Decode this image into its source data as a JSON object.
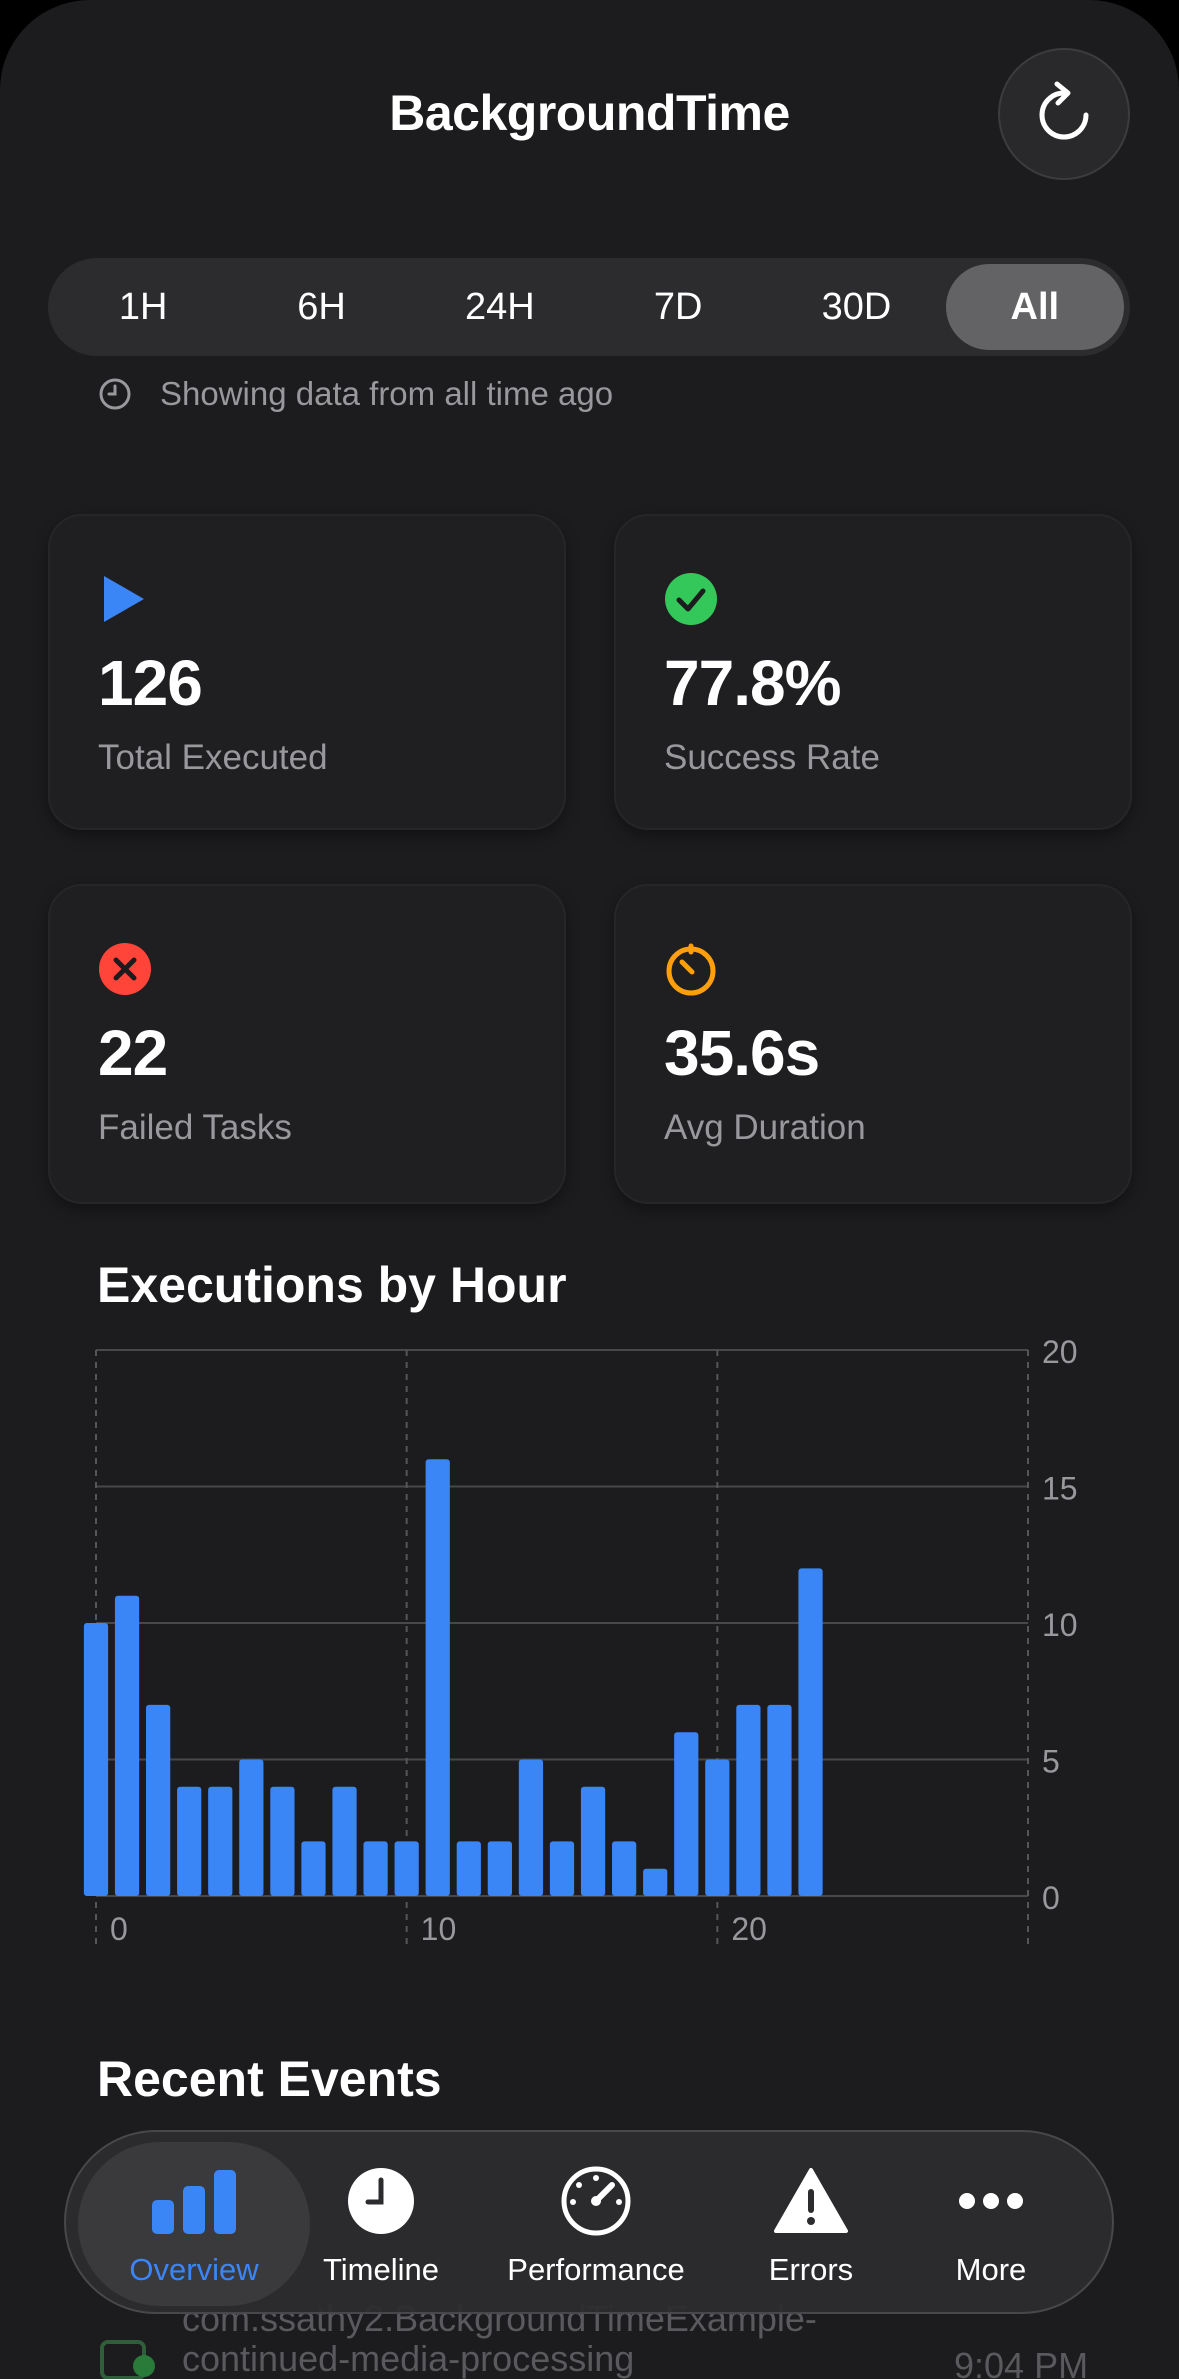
{
  "app": {
    "title": "BackgroundTime"
  },
  "refresh": {
    "icon": "refresh-icon"
  },
  "time_range": {
    "options": [
      "1H",
      "6H",
      "24H",
      "7D",
      "30D",
      "All"
    ],
    "selected": "All",
    "note": "Showing data from all time ago",
    "note_icon": "clock-icon"
  },
  "stats": [
    {
      "icon": "play-icon",
      "color": "#3a86f7",
      "value": "126",
      "label": "Total Executed"
    },
    {
      "icon": "checkmark-circle-icon",
      "color": "#34c759",
      "value": "77.8%",
      "label": "Success Rate"
    },
    {
      "icon": "x-circle-icon",
      "color": "#ff453a",
      "value": "22",
      "label": "Failed Tasks"
    },
    {
      "icon": "timer-icon",
      "color": "#ff9f0a",
      "value": "35.6s",
      "label": "Avg Duration"
    }
  ],
  "chart_section": {
    "title": "Executions by Hour"
  },
  "chart_data": {
    "type": "bar",
    "title": "Executions by Hour",
    "x": [
      0,
      1,
      2,
      3,
      4,
      5,
      6,
      7,
      8,
      9,
      10,
      11,
      12,
      13,
      14,
      15,
      16,
      17,
      18,
      19,
      20,
      21,
      22,
      23
    ],
    "values": [
      10,
      11,
      7,
      4,
      4,
      5,
      4,
      2,
      4,
      2,
      2,
      16,
      2,
      2,
      5,
      2,
      4,
      2,
      1,
      6,
      5,
      7,
      7,
      12
    ],
    "x_ticks": [
      "0",
      "10",
      "20"
    ],
    "y_ticks": [
      "0",
      "5",
      "10",
      "15",
      "20"
    ],
    "ylim": [
      0,
      20
    ],
    "xlim": [
      0,
      30
    ],
    "bar_color": "#3a86f7",
    "grid": true
  },
  "recent_events": {
    "title": "Recent Events",
    "peek_line1": "com.ssathy2.BackgroundTimeExample-",
    "peek_line2": "continued-media-processing",
    "peek_time": "9:04 PM"
  },
  "tabbar": {
    "tabs": [
      {
        "label": "Overview",
        "icon": "bar-chart-icon",
        "active": true
      },
      {
        "label": "Timeline",
        "icon": "clock-fill-icon",
        "active": false
      },
      {
        "label": "Performance",
        "icon": "gauge-icon",
        "active": false
      },
      {
        "label": "Errors",
        "icon": "warning-triangle-icon",
        "active": false
      },
      {
        "label": "More",
        "icon": "ellipsis-icon",
        "active": false
      }
    ]
  }
}
